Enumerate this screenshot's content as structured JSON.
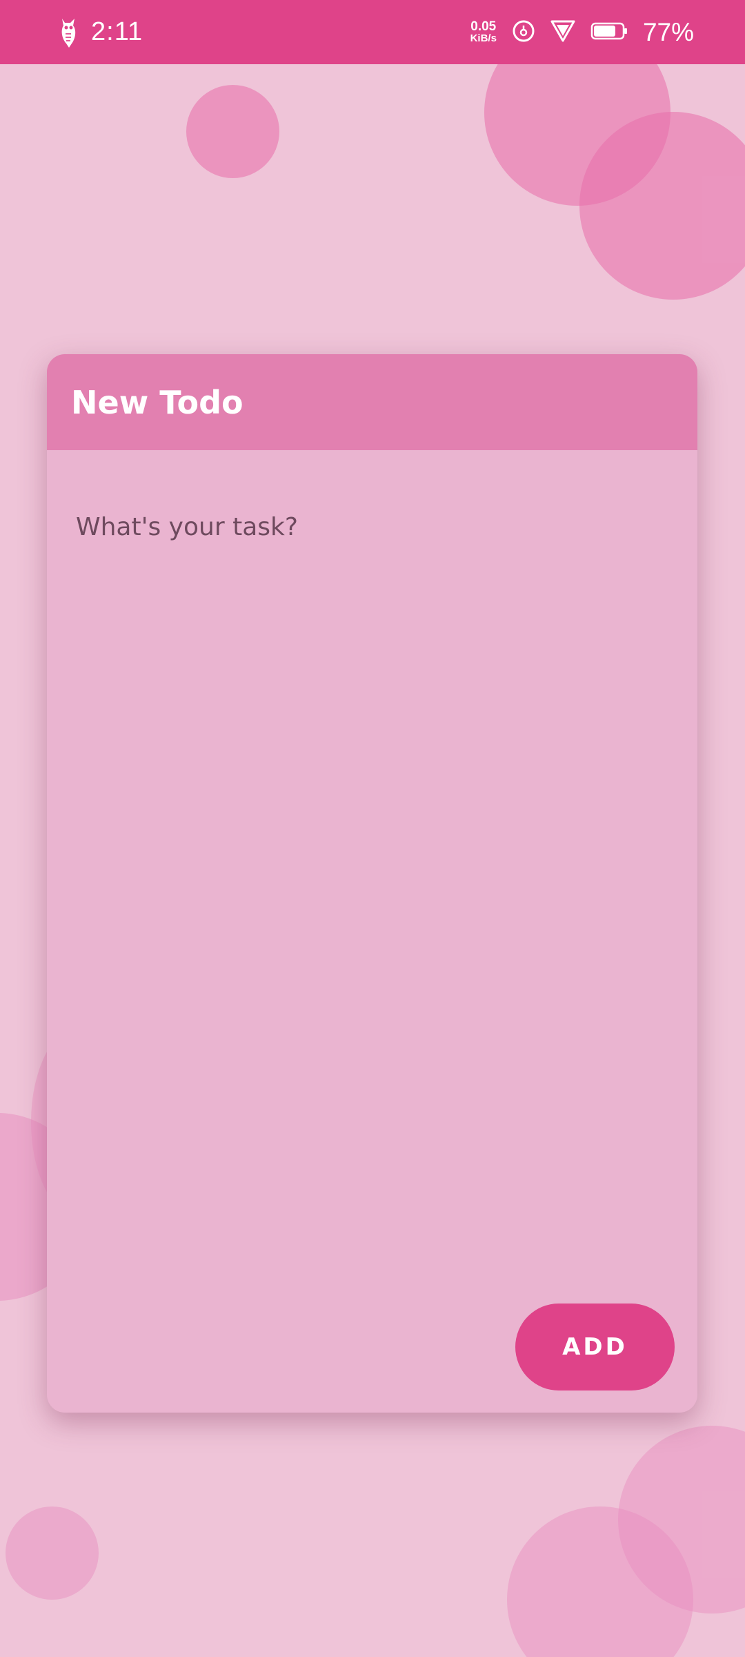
{
  "status_bar": {
    "time": "2:11",
    "net_speed_value": "0.05",
    "net_speed_unit": "KiB/s",
    "battery_percent": "77%",
    "battery_level": 0.77,
    "icons": [
      "owl-icon",
      "data-saver-icon",
      "signal-icon",
      "battery-icon"
    ],
    "color": "#df4389"
  },
  "dialog": {
    "title": "New Todo",
    "task_input": {
      "value": "",
      "placeholder": "What's your task?"
    },
    "add_button_label": "ADD"
  },
  "colors": {
    "accent": "#df4389",
    "header": "#e280b0",
    "card": "#eab4d0",
    "background": "#efc4d8"
  }
}
